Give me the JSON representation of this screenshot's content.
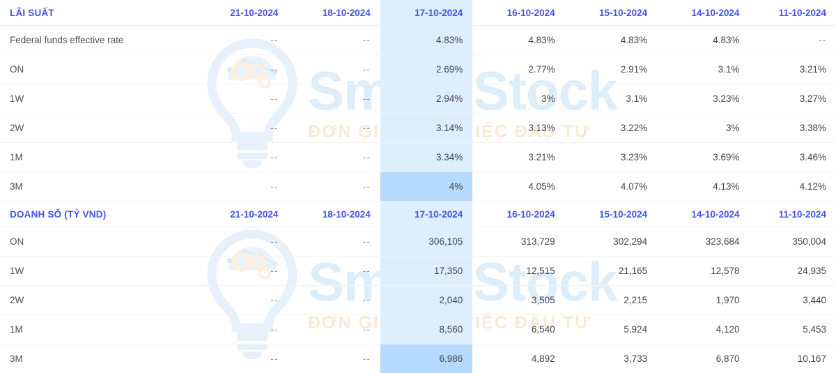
{
  "watermark": {
    "title": "Smart Stock",
    "subtitle": "ĐƠN GIẢN HÓA VIỆC ĐẦU TƯ",
    "logo_icon": "lightbulb-gears-icon",
    "title_color": "#ddeefb",
    "subtitle_color": "#fbead3"
  },
  "theme": {
    "header_text_color": "#4353e8",
    "body_text_color": "#40454f",
    "highlight_column_bg": "#ddeefc",
    "highlight_row_bg": "#b5dafb",
    "row_border_color": "#f2f3f6"
  },
  "dash_placeholder": "--",
  "highlighted_column_index": 2,
  "sections": [
    {
      "title": "LÃI SUẤT",
      "columns": [
        "21-10-2024",
        "18-10-2024",
        "17-10-2024",
        "16-10-2024",
        "15-10-2024",
        "14-10-2024",
        "11-10-2024"
      ],
      "rows": [
        {
          "label": "Federal funds effective rate",
          "values": [
            "--",
            "--",
            "4.83%",
            "4.83%",
            "4.83%",
            "4.83%",
            "--"
          ]
        },
        {
          "label": "ON",
          "values": [
            "--",
            "--",
            "2.69%",
            "2.77%",
            "2.91%",
            "3.1%",
            "3.21%"
          ]
        },
        {
          "label": "1W",
          "values": [
            "--",
            "--",
            "2.94%",
            "3%",
            "3.1%",
            "3.23%",
            "3.27%"
          ]
        },
        {
          "label": "2W",
          "values": [
            "--",
            "--",
            "3.14%",
            "3.13%",
            "3.22%",
            "3%",
            "3.38%"
          ]
        },
        {
          "label": "1M",
          "values": [
            "--",
            "--",
            "3.34%",
            "3.21%",
            "3.23%",
            "3.69%",
            "3.46%"
          ]
        },
        {
          "label": "3M",
          "values": [
            "--",
            "--",
            "4%",
            "4.05%",
            "4.07%",
            "4.13%",
            "4.12%"
          ],
          "hover": true
        }
      ]
    },
    {
      "title": "DOANH SỐ (TỶ VND)",
      "columns": [
        "21-10-2024",
        "18-10-2024",
        "17-10-2024",
        "16-10-2024",
        "15-10-2024",
        "14-10-2024",
        "11-10-2024"
      ],
      "rows": [
        {
          "label": "ON",
          "values": [
            "--",
            "--",
            "306,105",
            "313,729",
            "302,294",
            "323,684",
            "350,004"
          ]
        },
        {
          "label": "1W",
          "values": [
            "--",
            "--",
            "17,350",
            "12,515",
            "21,165",
            "12,578",
            "24,935"
          ]
        },
        {
          "label": "2W",
          "values": [
            "--",
            "--",
            "2,040",
            "3,505",
            "2,215",
            "1,970",
            "3,440"
          ]
        },
        {
          "label": "1M",
          "values": [
            "--",
            "--",
            "8,560",
            "6,540",
            "5,924",
            "4,120",
            "5,453"
          ]
        },
        {
          "label": "3M",
          "values": [
            "--",
            "--",
            "6,986",
            "4,892",
            "3,733",
            "6,870",
            "10,167"
          ],
          "hover": true
        }
      ]
    }
  ]
}
